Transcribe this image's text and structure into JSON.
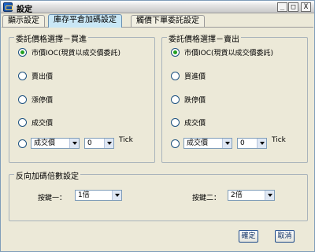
{
  "window": {
    "title": "設定",
    "min": "_",
    "max": "□",
    "close": "X"
  },
  "tabs": [
    {
      "label": "顯示設定",
      "active": false
    },
    {
      "label": "庫存平倉加碼設定",
      "active": true
    },
    {
      "label": "觸價下單委託設定",
      "active": false
    }
  ],
  "buy_group": {
    "legend": "委託價格選擇－買進",
    "options": [
      "市價IOC(現貨以成交價委託)",
      "賣出價",
      "漲停價",
      "成交價"
    ],
    "selected_index": 0,
    "custom": {
      "price_type": "成交價",
      "offset": "0",
      "unit": "Tick"
    }
  },
  "sell_group": {
    "legend": "委託價格選擇－賣出",
    "options": [
      "市價IOC(現貨以成交價委託)",
      "買進價",
      "跌停價",
      "成交價"
    ],
    "selected_index": 0,
    "custom": {
      "price_type": "成交價",
      "offset": "0",
      "unit": "Tick"
    }
  },
  "multiplier_group": {
    "legend": "反向加碼倍數設定",
    "key1": {
      "label": "按鍵一：",
      "value": "1倍"
    },
    "key2": {
      "label": "按鍵二：",
      "value": "2倍"
    }
  },
  "buttons": {
    "ok": "確定",
    "cancel": "取消"
  },
  "colors": {
    "active_tab": "#c9e7f5",
    "window_bg": "#ece9d8",
    "radio_dot": "#22a022"
  }
}
